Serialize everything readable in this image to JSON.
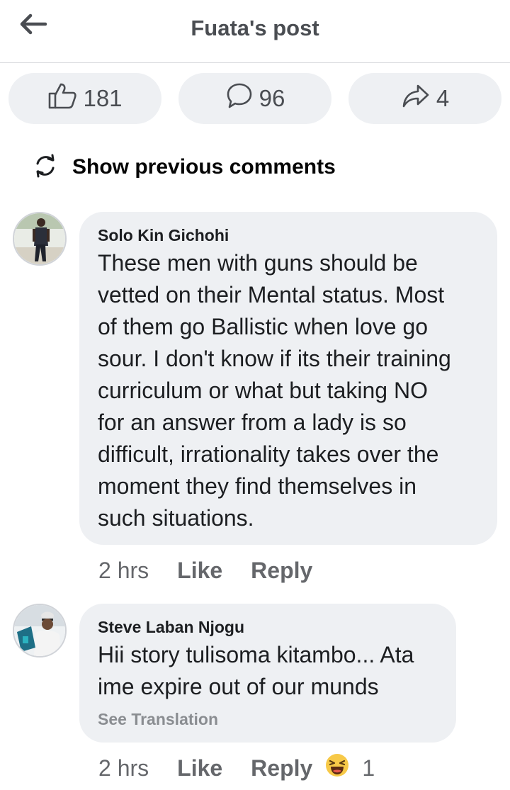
{
  "header": {
    "title": "Fuata's post",
    "back_icon": "arrow-left-icon"
  },
  "stats": {
    "likes": "181",
    "comments": "96",
    "shares": "4"
  },
  "show_previous": {
    "label": "Show previous comments",
    "icon": "refresh-icon"
  },
  "comments": [
    {
      "author": "Solo Kin Gichohi",
      "lines": [
        "These men with guns should be",
        "vetted on their Mental status. Most",
        "of them go Ballistic when love go",
        "sour. I don't know if its their training",
        "curriculum or what but taking NO",
        "for an answer from a lady is so",
        "difficult, irrationality takes over the",
        "moment they find themselves in",
        "such situations."
      ],
      "time": "2 hrs",
      "like_label": "Like",
      "reply_label": "Reply"
    },
    {
      "author": "Steve Laban Njogu",
      "lines": [
        "Hii story tulisoma kitambo... Ata",
        "ime expire out of our munds"
      ],
      "see_translation": "See Translation",
      "time": "2 hrs",
      "like_label": "Like",
      "reply_label": "Reply",
      "reaction_icon": "laughing-emoji-icon",
      "reaction_count": "1"
    }
  ],
  "colors": {
    "pill_bg": "#eef0f3",
    "bubble_bg": "#eef0f3",
    "meta_text": "#65676b"
  }
}
